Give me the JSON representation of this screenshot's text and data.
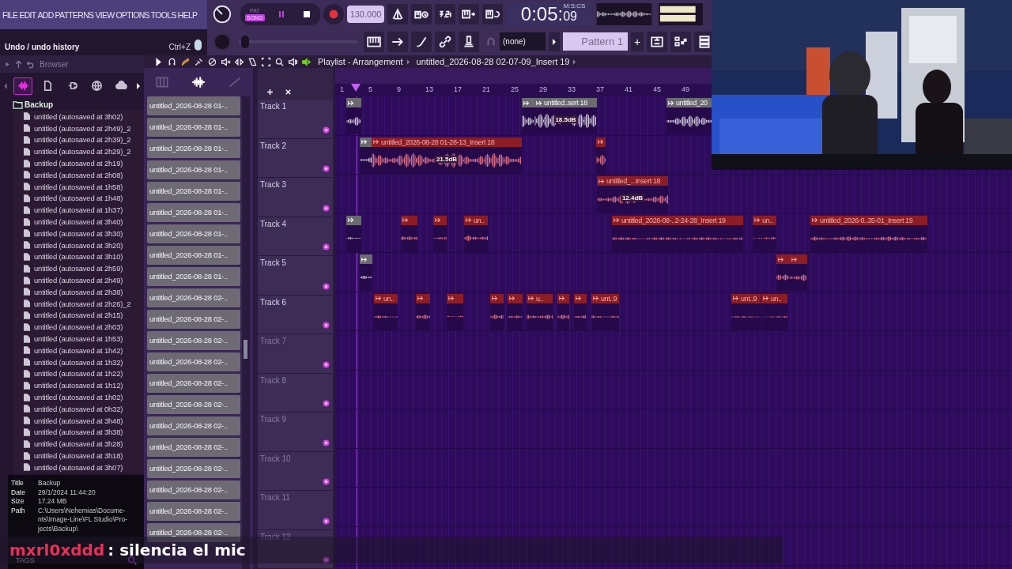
{
  "menu": [
    "FILE",
    "EDIT",
    "ADD",
    "PATTERNS",
    "VIEW",
    "OPTIONS",
    "TOOLS",
    "HELP"
  ],
  "hint": {
    "text": "Undo / undo history",
    "shortcut": "Ctrl+Z"
  },
  "transport": {
    "modes": [
      {
        "label": "PAT",
        "selected": false
      },
      {
        "label": "SONG",
        "selected": true
      }
    ]
  },
  "tempo": "130.000",
  "master_slider": {
    "level": 0.02
  },
  "time": {
    "main": "0:05:",
    "fraction": "09",
    "format": "M:S:CS"
  },
  "pattern_selector": {
    "channel": "(none)",
    "pattern": "Pattern 1",
    "add": "+"
  },
  "browser": {
    "title": "Browser",
    "tabs": [
      {
        "selected": true
      },
      {
        "selected": false
      },
      {
        "selected": false
      },
      {
        "selected": false
      },
      {
        "selected": false
      }
    ],
    "folder": "Backup",
    "items": [
      "untitled (autosaved at 3h02)",
      "untitled (autosaved at 2h49)_2",
      "untitled (autosaved at 2h39)_2",
      "untitled (autosaved at 2h29)_2",
      "untitled (autosaved at 2h19)",
      "untitled (autosaved at 2h08)",
      "untitled (autosaved at 1h58)",
      "untitled (autosaved at 1h48)",
      "untitled (autosaved at 1h37)",
      "untitled (autosaved at 3h40)",
      "untitled (autosaved at 3h30)",
      "untitled (autosaved at 3h20)",
      "untitled (autosaved at 3h10)",
      "untitled (autosaved at 2h59)",
      "untitled (autosaved at 2h49)",
      "untitled (autosaved at 2h38)",
      "untitled (autosaved at 2h26)_2",
      "untitled (autosaved at 2h15)",
      "untitled (autosaved at 2h03)",
      "untitled (autosaved at 1h53)",
      "untitled (autosaved at 1h42)",
      "untitled (autosaved at 1h32)",
      "untitled (autosaved at 1h22)",
      "untitled (autosaved at 1h12)",
      "untitled (autosaved at 1h02)",
      "untitled (autosaved at 0h32)",
      "untitled (autosaved at 3h48)",
      "untitled (autosaved at 3h38)",
      "untitled (autosaved at 3h28)",
      "untitled (autosaved at 3h18)",
      "untitled (autosaved at 3h07)"
    ],
    "info": [
      {
        "label": "Title",
        "lines": [
          "Backup"
        ]
      },
      {
        "label": "Date",
        "lines": [
          "29/1/2024 11:44:20"
        ]
      },
      {
        "label": "Size",
        "lines": [
          "17.24 MB"
        ]
      },
      {
        "label": "Path",
        "lines": [
          "C:\\Users\\Nehemias\\Docume-",
          "nts\\Image-Line\\FL Studio\\Pro-",
          "jects\\Backup\\"
        ]
      }
    ],
    "tags": "TAGS"
  },
  "patterns": [
    "untitled_2026-08-28 01-..",
    "untitled_2026-08-28 01-..",
    "untitled_2026-08-28 01-..",
    "untitled_2026-08-28 01-..",
    "untitled_2026-08-28 01-..",
    "untitled_2026-08-28 01-..",
    "untitled_2026-08-28 01-..",
    "untitled_2026-08-28 01-..",
    "untitled_2026-08-28 01-..",
    "untitled_2026-08-28 02-..",
    "untitled_2026-08-28 02-..",
    "untitled_2026-08-28 02-..",
    "untitled_2026-08-28 02-..",
    "untitled_2026-08-28 02-..",
    "untitled_2026-08-28 02-..",
    "untitled_2026-08-28 02-..",
    "untitled_2026-08-28 02-..",
    "untitled_2026-08-28 02-..",
    "untitled_2026-08-28 02-..",
    "untitled_2026-08-28 02-..",
    "untitled_2026-08-28 02-.."
  ],
  "playlist": {
    "title": "Playlist - Arrangement",
    "breadcrumb": "untitled_2026-08-28 02-07-09_Insert 19",
    "ruler": [
      "1",
      "5",
      "9",
      "13",
      "17",
      "21",
      "25",
      "29",
      "33",
      "37",
      "41",
      "45",
      "49"
    ],
    "tracks": [
      {
        "name": "Track 1",
        "clips": [
          {
            "color": "#6a6a70"
          },
          {
            "color": "#6a6a70"
          },
          {
            "label": "untitled..sert 18",
            "color": "#6a6a70",
            "peak": "18.5dB"
          },
          {
            "label": "untitled_20",
            "color": "#6a6a70"
          }
        ]
      },
      {
        "name": "Track 2",
        "clips": [
          {
            "color": "#6a6a70"
          },
          {
            "label": "untitled_2026-08-28 01-28-13_Insert 18",
            "color": "#8c1d24",
            "peak": "21.5dB"
          },
          {
            "color": "#8c1d24"
          }
        ]
      },
      {
        "name": "Track 3",
        "clips": [
          {
            "label": "untitled_...Insert 18",
            "color": "#8c1d24",
            "peak": "12.4dB"
          }
        ]
      },
      {
        "name": "Track 4",
        "clips": [
          {
            "color": "#6a6a70"
          },
          {
            "color": "#8c1d24"
          },
          {
            "color": "#8c1d24"
          },
          {
            "label": "un..",
            "color": "#8c1d24"
          },
          {
            "label": "untitled_2026-08-..2-24-28_Insert 19",
            "color": "#8c1d24"
          },
          {
            "label": "un..",
            "color": "#8c1d24"
          },
          {
            "label": "untitled_2026-0..35-01_Insert 19",
            "color": "#8c1d24"
          }
        ]
      },
      {
        "name": "Track 5",
        "clips": [
          {
            "color": "#6a6a70"
          },
          {
            "color": "#8c1d24"
          },
          {
            "color": "#8c1d24"
          }
        ]
      },
      {
        "name": "Track 6",
        "clips": [
          {
            "label": "un..",
            "color": "#8c1d24"
          },
          {
            "color": "#8c1d24"
          },
          {
            "color": "#8c1d24"
          },
          {
            "color": "#8c1d24"
          },
          {
            "color": "#8c1d24"
          },
          {
            "label": "u..",
            "color": "#8c1d24"
          },
          {
            "color": "#8c1d24"
          },
          {
            "color": "#8c1d24"
          },
          {
            "label": "unt..9",
            "color": "#8c1d24"
          },
          {
            "label": "unt..9",
            "color": "#8c1d24"
          },
          {
            "label": "un..",
            "color": "#8c1d24"
          }
        ]
      },
      {
        "name": "Track 7"
      },
      {
        "name": "Track 8"
      },
      {
        "name": "Track 9"
      },
      {
        "name": "Track 10"
      },
      {
        "name": "Track 11"
      },
      {
        "name": "Track 12"
      }
    ]
  },
  "chat": {
    "user": "mxrl0xddd",
    "message": ": silencia el mic"
  }
}
